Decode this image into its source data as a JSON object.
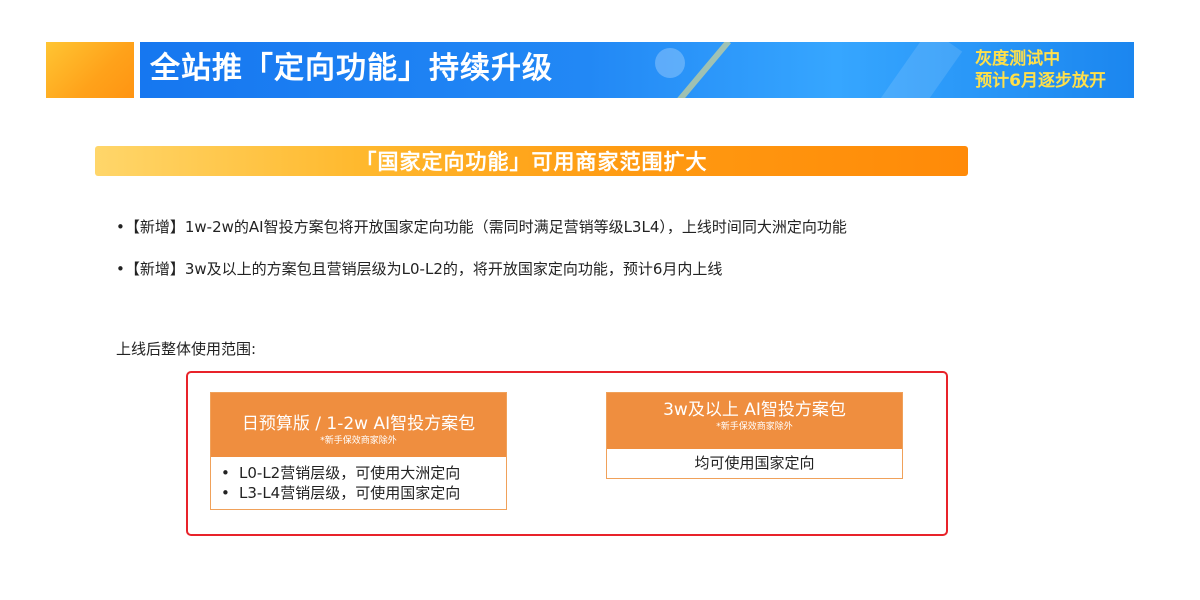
{
  "header": {
    "title": "全站推「定向功能」持续升级",
    "badge_line1": "灰度测试中",
    "badge_line2": "预计6月逐步放开"
  },
  "banner": {
    "text": "「国家定向功能」可用商家范围扩大"
  },
  "bullets": [
    "•【新增】1w-2w的AI智投方案包将开放国家定向功能（需同时满足营销等级L3L4），上线时间同大洲定向功能",
    "•【新增】3w及以上的方案包且营销层级为L0-L2的，将开放国家定向功能，预计6月内上线"
  ],
  "scope_label": "上线后整体使用范围:",
  "cards": [
    {
      "title": "日预算版 / 1-2w AI智投方案包",
      "note": "*新手保效商家除外",
      "items": [
        "L0-L2营销层级，可使用大洲定向",
        "L3-L4营销层级，可使用国家定向"
      ]
    },
    {
      "title": "3w及以上 AI智投方案包",
      "note": "*新手保效商家除外",
      "body": "均可使用国家定向"
    }
  ],
  "colors": {
    "header_blue": "#1677f0",
    "accent_orange": "#ffa21a",
    "badge_yellow": "#ffe04a",
    "card_orange": "#ef8e3f",
    "frame_red": "#e8232a"
  }
}
